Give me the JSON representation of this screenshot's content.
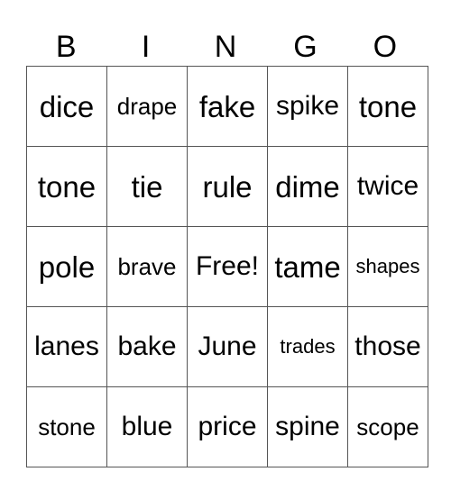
{
  "header": [
    "B",
    "I",
    "N",
    "G",
    "O"
  ],
  "rows": [
    [
      "dice",
      "drape",
      "fake",
      "spike",
      "tone"
    ],
    [
      "tone",
      "tie",
      "rule",
      "dime",
      "twice"
    ],
    [
      "pole",
      "brave",
      "Free!",
      "tame",
      "shapes"
    ],
    [
      "lanes",
      "bake",
      "June",
      "trades",
      "those"
    ],
    [
      "stone",
      "blue",
      "price",
      "spine",
      "scope"
    ]
  ]
}
